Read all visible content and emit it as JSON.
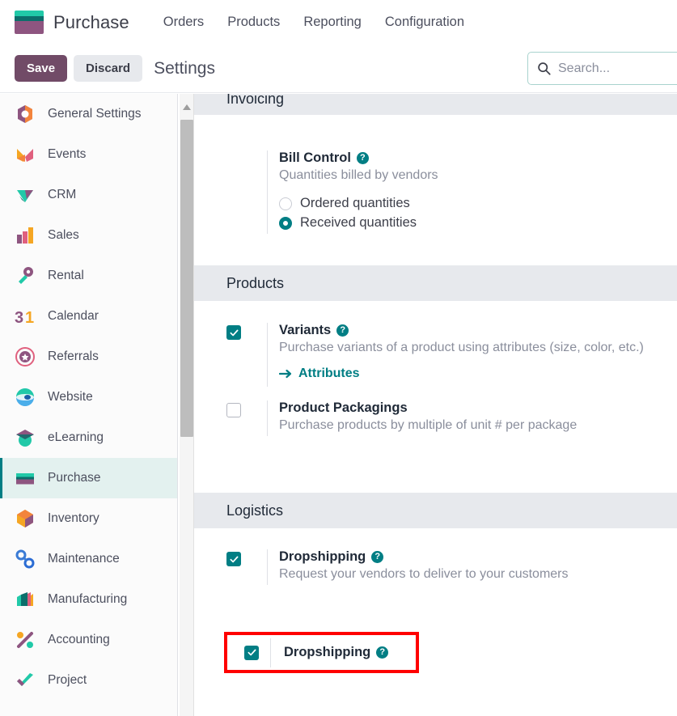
{
  "app": {
    "name": "Purchase",
    "logo_icon": "purchase-card-logo"
  },
  "navbar": {
    "items": [
      {
        "label": "Orders"
      },
      {
        "label": "Products"
      },
      {
        "label": "Reporting"
      },
      {
        "label": "Configuration"
      }
    ]
  },
  "control_panel": {
    "save_label": "Save",
    "discard_label": "Discard",
    "page_title": "Settings",
    "search": {
      "placeholder": "Search...",
      "value": "",
      "icon": "search-icon"
    }
  },
  "sidebar": {
    "active": "Purchase",
    "items": [
      {
        "label": "General Settings",
        "icon": "settings-gear-icon"
      },
      {
        "label": "Events",
        "icon": "events-icon"
      },
      {
        "label": "CRM",
        "icon": "crm-icon"
      },
      {
        "label": "Sales",
        "icon": "sales-bars-icon"
      },
      {
        "label": "Rental",
        "icon": "rental-key-icon"
      },
      {
        "label": "Calendar",
        "icon": "calendar-31-icon"
      },
      {
        "label": "Referrals",
        "icon": "referrals-badge-icon"
      },
      {
        "label": "Website",
        "icon": "website-globe-icon"
      },
      {
        "label": "eLearning",
        "icon": "elearning-cap-icon"
      },
      {
        "label": "Purchase",
        "icon": "purchase-card-icon"
      },
      {
        "label": "Inventory",
        "icon": "inventory-box-icon"
      },
      {
        "label": "Maintenance",
        "icon": "maintenance-wrench-icon"
      },
      {
        "label": "Manufacturing",
        "icon": "manufacturing-icon"
      },
      {
        "label": "Accounting",
        "icon": "accounting-percent-icon"
      },
      {
        "label": "Project",
        "icon": "project-check-icon"
      }
    ],
    "scrollbar": {
      "up_arrow_icon": "scroll-up-arrow-icon"
    }
  },
  "settings": {
    "sections": [
      {
        "title": "Invoicing",
        "clipped": true,
        "settings": [
          {
            "name": "bill-control",
            "title": "Bill Control",
            "help_icon": "help-question-icon",
            "description": "Quantities billed by vendors",
            "type": "radio-group",
            "options": [
              {
                "label": "Ordered quantities",
                "selected": false
              },
              {
                "label": "Received quantities",
                "selected": true
              }
            ]
          }
        ]
      },
      {
        "title": "Products",
        "clipped": false,
        "settings": [
          {
            "name": "variants",
            "title": "Variants",
            "help_icon": "help-question-icon",
            "description": "Purchase variants of a product using attributes (size, color, etc.)",
            "type": "checkbox",
            "checked": true,
            "link": {
              "label": "Attributes",
              "icon": "arrow-right-icon"
            }
          },
          {
            "name": "product-packagings",
            "title": "Product Packagings",
            "help_icon": null,
            "description": "Purchase products by multiple of unit # per package",
            "type": "checkbox",
            "checked": false
          }
        ]
      },
      {
        "title": "Logistics",
        "clipped": false,
        "settings": [
          {
            "name": "dropshipping",
            "title": "Dropshipping",
            "help_icon": "help-question-icon",
            "description": "Request your vendors to deliver to your customers",
            "type": "checkbox",
            "checked": true,
            "highlighted": true
          }
        ]
      }
    ]
  },
  "annotation": {
    "highlight_color": "#FF0000",
    "target": "dropshipping-setting"
  },
  "colors": {
    "brand_purple": "#714B67",
    "accent_teal": "#017E84",
    "section_header_bg": "#E7E9ED",
    "sidebar_active_bg": "#E3F1EF",
    "muted_text": "#8A8E9C"
  }
}
